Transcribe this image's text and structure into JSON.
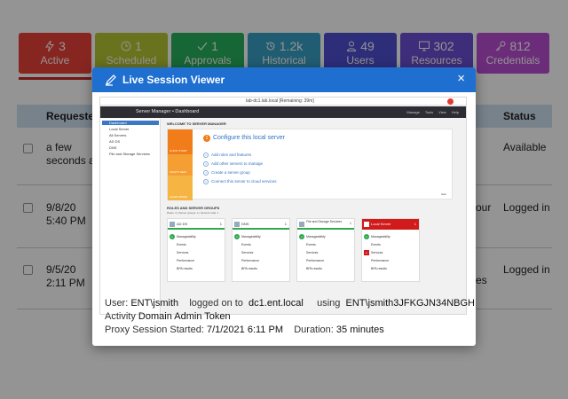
{
  "tiles": [
    {
      "count": "3",
      "label": "Active",
      "color": "#e8413a",
      "icon": "lightning-icon"
    },
    {
      "count": "1",
      "label": "Scheduled",
      "color": "#b6c531",
      "icon": "clock-icon"
    },
    {
      "count": "1",
      "label": "Approvals",
      "color": "#27b15c",
      "icon": "check-icon"
    },
    {
      "count": "1.2k",
      "label": "Historical",
      "color": "#3aa0c4",
      "icon": "history-icon"
    },
    {
      "count": "49",
      "label": "Users",
      "color": "#4e4ed2",
      "icon": "user-icon"
    },
    {
      "count": "302",
      "label": "Resources",
      "color": "#6b4ed2",
      "icon": "monitor-icon"
    },
    {
      "count": "812",
      "label": "Credentials",
      "color": "#b84fd1",
      "icon": "key-icon"
    }
  ],
  "table": {
    "headers": {
      "requested": "Requested",
      "status": "Status"
    },
    "rows": [
      {
        "requested": [
          "a few",
          "seconds a"
        ],
        "middle": "",
        "status": "Available"
      },
      {
        "requested": [
          "9/8/20",
          "5:40 PM"
        ],
        "middle": "our",
        "status": "Logged in"
      },
      {
        "requested": [
          "9/5/20",
          "2:11 PM"
        ],
        "middle": "es",
        "status": "Logged in"
      }
    ]
  },
  "modal": {
    "title": "Live Session Viewer",
    "close": "×",
    "remote": {
      "window_title": "lab-dc1.lab.local [Remaining: 39m]",
      "app_title": "Server Manager • Dashboard",
      "menus": [
        "Manage",
        "Tools",
        "View",
        "Help"
      ],
      "sidebar": [
        "Dashboard",
        "Local Server",
        "All Servers",
        "AD DS",
        "DNS",
        "File and Storage Services"
      ],
      "welcome": "WELCOME TO SERVER MANAGER",
      "main_task": "Configure this local server",
      "tasks": [
        "Add roles and features",
        "Add other servers to manage",
        "Create a server group",
        "Connect this server to cloud services"
      ],
      "quick_labels": [
        "QUICK START",
        "WHAT'S NEW",
        "LEARN MORE"
      ],
      "hide": "Hide",
      "roles_title": "ROLES AND SERVER GROUPS",
      "roles_sub": "Roles: 3 | Server groups: 1 | Servers total: 1",
      "cards": [
        {
          "name": "AD DS",
          "count": "1",
          "red": false,
          "rows": [
            "Manageability",
            "Events",
            "Services",
            "Performance",
            "BPA results"
          ]
        },
        {
          "name": "DNS",
          "count": "1",
          "red": false,
          "rows": [
            "Manageability",
            "Events",
            "Services",
            "Performance",
            "BPA results"
          ]
        },
        {
          "name": "File and Storage Services",
          "count": "1",
          "red": false,
          "rows": [
            "Manageability",
            "Events",
            "Services",
            "Performance",
            "BPA results"
          ]
        },
        {
          "name": "Local Server",
          "count": "1",
          "red": true,
          "rows": [
            "Manageability",
            "Events",
            "Services",
            "Performance",
            "BPA results"
          ]
        }
      ]
    },
    "info": {
      "user_label": "User:",
      "user": "ENT\\jsmith",
      "logged_on_label": "logged on to",
      "host": "dc1.ent.local",
      "using_label": "using",
      "credential": "ENT\\jsmith3JFKGJN34NBGH",
      "activity_label": "Activity",
      "activity": "Domain Admin Token",
      "started_label": "Proxy Session Started:",
      "started": "7/1/2021 6:11 PM",
      "duration_label": "Duration:",
      "duration": "35 minutes"
    }
  }
}
